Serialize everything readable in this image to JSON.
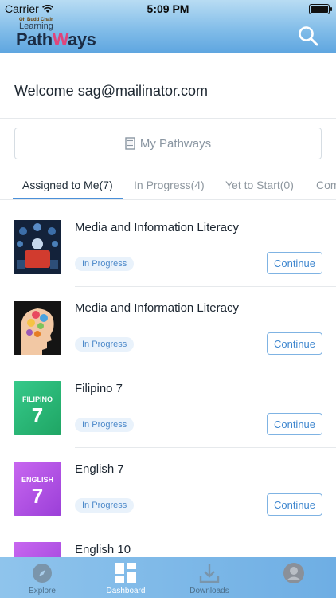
{
  "status_bar": {
    "carrier": "Carrier",
    "time": "5:09 PM"
  },
  "header": {
    "logo_tagline": "Oh Budd Chair",
    "logo_learning": "Learning",
    "logo_path": "Path",
    "logo_w": "W",
    "logo_ays": "ays"
  },
  "welcome": "Welcome sag@mailinator.com",
  "my_pathways_label": "My Pathways",
  "tabs": [
    {
      "label": "Assigned to Me(7)",
      "active": true
    },
    {
      "label": "In Progress(4)",
      "active": false
    },
    {
      "label": "Yet to Start(0)",
      "active": false
    },
    {
      "label": "Com",
      "active": false
    }
  ],
  "items": [
    {
      "title": "Media and Information Literacy",
      "status": "In Progress",
      "action": "Continue",
      "thumb": "media-icon"
    },
    {
      "title": "Media and Information Literacy",
      "status": "In Progress",
      "action": "Continue",
      "thumb": "head-icon"
    },
    {
      "title": "Filipino 7",
      "status": "In Progress",
      "action": "Continue",
      "thumb": "filipino",
      "thumb_label": "FILIPINO",
      "thumb_number": "7",
      "color": "#2bb673"
    },
    {
      "title": "English 7",
      "status": "In Progress",
      "action": "Continue",
      "thumb": "english",
      "thumb_label": "ENGLISH",
      "thumb_number": "7",
      "color": "#b44ee8"
    },
    {
      "title": "English 10",
      "thumb": "english10",
      "color": "#b44ee8"
    }
  ],
  "tabbar": [
    {
      "label": "Explore",
      "icon": "compass-icon"
    },
    {
      "label": "Dashboard",
      "icon": "dashboard-icon",
      "active": true
    },
    {
      "label": "Downloads",
      "icon": "download-icon"
    },
    {
      "label": "",
      "icon": "profile-icon"
    }
  ]
}
